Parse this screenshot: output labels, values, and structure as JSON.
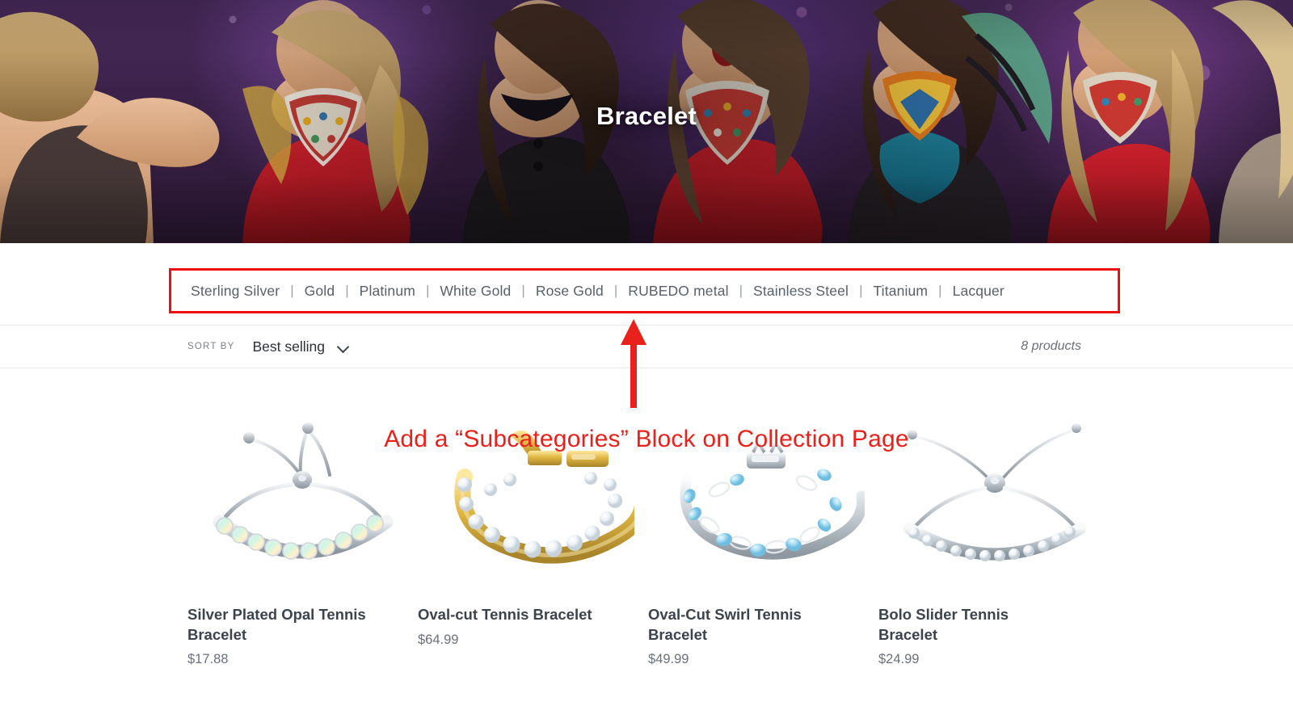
{
  "hero": {
    "title": "Bracelet",
    "image_alt": "fashion-show-models-runway-photo"
  },
  "subcategories": {
    "separator": "|",
    "items": [
      {
        "label": "Sterling Silver"
      },
      {
        "label": "Gold"
      },
      {
        "label": "Platinum"
      },
      {
        "label": "White Gold"
      },
      {
        "label": "Rose Gold"
      },
      {
        "label": "RUBEDO metal"
      },
      {
        "label": "Stainless Steel"
      },
      {
        "label": "Titanium"
      },
      {
        "label": "Lacquer"
      }
    ]
  },
  "sortbar": {
    "label": "SORT BY",
    "selected": "Best selling",
    "options": [
      "Best selling"
    ],
    "product_count": "8 products"
  },
  "products": [
    {
      "title": "Silver Plated Opal Tennis Bracelet",
      "price": "$17.88",
      "image_alt": "silver-opal-bolo-tennis-bracelet"
    },
    {
      "title": "Oval-cut Tennis Bracelet",
      "price": "$64.99",
      "image_alt": "gold-diamond-tennis-bracelet"
    },
    {
      "title": "Oval-Cut Swirl Tennis Bracelet",
      "price": "$49.99",
      "image_alt": "silver-aquamarine-swirl-tennis-bracelet"
    },
    {
      "title": "Bolo Slider Tennis Bracelet",
      "price": "$24.99",
      "image_alt": "silver-bolo-slider-tennis-bracelet"
    }
  ],
  "annotation": {
    "text": "Add a “Subcategories” Block on Collection Page",
    "color": "#e8211c",
    "arrow": "up-arrow"
  },
  "colors": {
    "annotation_red": "#e8211c",
    "highlight_box_red": "#f00f0f",
    "text_dark": "#3b434d",
    "text_muted": "#6a717d",
    "link": "#58606a",
    "divider": "#e8e9eb"
  }
}
